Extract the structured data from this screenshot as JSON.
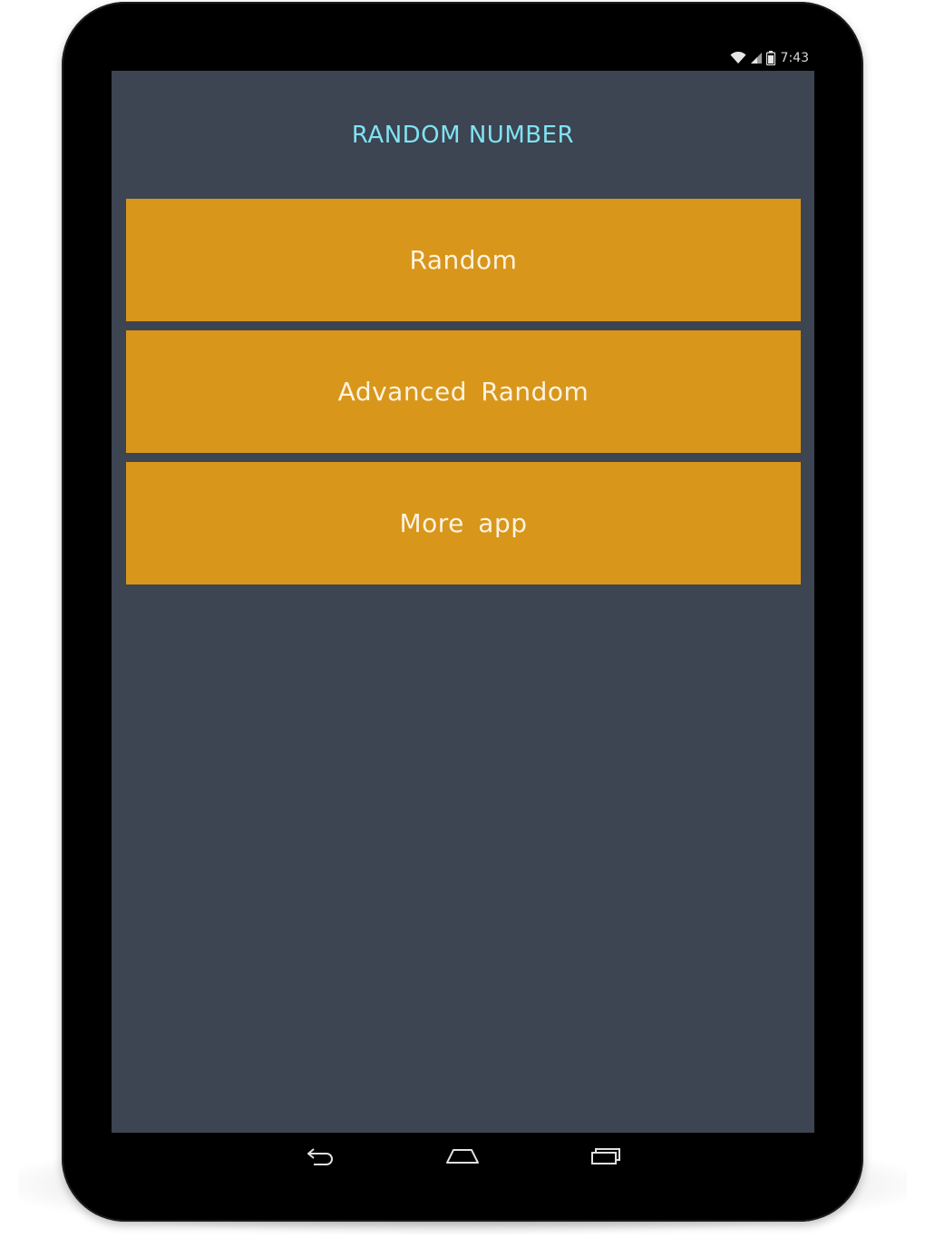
{
  "status_bar": {
    "time": "7:43",
    "icons": [
      "wifi-icon",
      "cell-signal-icon",
      "battery-icon"
    ]
  },
  "app": {
    "title": "RANDOM NUMBER",
    "buttons": [
      {
        "label": "Random"
      },
      {
        "label": "Advanced Random"
      },
      {
        "label": "More app"
      }
    ]
  },
  "nav_bar": {
    "icons": [
      "back-icon",
      "home-icon",
      "recent-apps-icon"
    ]
  },
  "colors": {
    "screen_background": "#3d4452",
    "button_background": "#d8961b",
    "button_text": "#fdf3e0",
    "title_text": "#7fe3f2",
    "device_bezel": "#000000"
  }
}
